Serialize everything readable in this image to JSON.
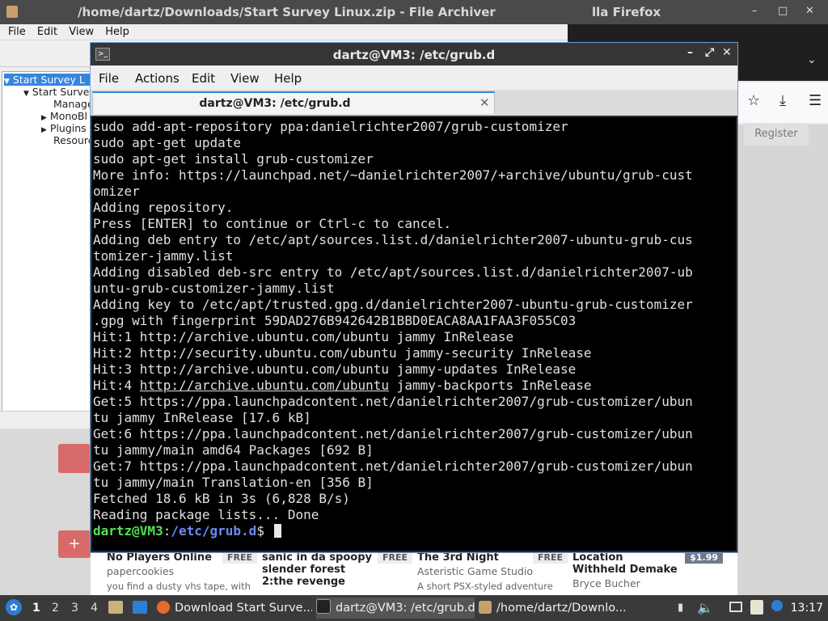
{
  "top_bar": {
    "archiver_title": "/home/dartz/Downloads/Start Survey Linux.zip - File Archiver",
    "firefox_title_fragment": "lla Firefox"
  },
  "archiver": {
    "menu": [
      "File",
      "Edit",
      "View",
      "Help"
    ],
    "tree": [
      "Start Survey L",
      "Start Surve",
      "Manage",
      "MonoBl",
      "Plugins",
      "Resourc"
    ]
  },
  "firefox": {
    "register_label": "Register"
  },
  "store": [
    {
      "title": "No Players Online",
      "price": "FREE",
      "studio": "papercookies",
      "desc": "you find a dusty vhs tape, with"
    },
    {
      "title": "sanic in da spoopy slender forest 2:the revenge",
      "price": "FREE",
      "studio": "",
      "desc": ""
    },
    {
      "title": "The 3rd Night",
      "price": "FREE",
      "studio": "Asteristic Game Studio",
      "desc": "A short PSX-styled adventure"
    },
    {
      "title": "Location Withheld Demake",
      "price": "$1.99",
      "studio": "Bryce Bucher",
      "desc": ""
    }
  ],
  "terminal": {
    "window_title": "dartz@VM3: /etc/grub.d",
    "menu": [
      "File",
      "Actions",
      "Edit",
      "View",
      "Help"
    ],
    "tab_title": "dartz@VM3: /etc/grub.d",
    "lines": [
      "sudo add-apt-repository ppa:danielrichter2007/grub-customizer",
      "sudo apt-get update",
      "sudo apt-get install grub-customizer",
      "More info: https://launchpad.net/~danielrichter2007/+archive/ubuntu/grub-cust",
      "omizer",
      "Adding repository.",
      "Press [ENTER] to continue or Ctrl-c to cancel.",
      "Adding deb entry to /etc/apt/sources.list.d/danielrichter2007-ubuntu-grub-cus",
      "tomizer-jammy.list",
      "Adding disabled deb-src entry to /etc/apt/sources.list.d/danielrichter2007-ub",
      "untu-grub-customizer-jammy.list",
      "Adding key to /etc/apt/trusted.gpg.d/danielrichter2007-ubuntu-grub-customizer",
      ".gpg with fingerprint 59DAD276B942642B1BBD0EACA8AA1FAA3F055C03",
      "Hit:1 http://archive.ubuntu.com/ubuntu jammy InRelease",
      "Hit:2 http://security.ubuntu.com/ubuntu jammy-security InRelease",
      "Hit:3 http://archive.ubuntu.com/ubuntu jammy-updates InRelease"
    ],
    "hit4_prefix": "Hit:4 ",
    "hit4_link": "http://archive.ubuntu.com/ubuntu",
    "hit4_suffix": " jammy-backports InRelease",
    "lines_after": [
      "Get:5 https://ppa.launchpadcontent.net/danielrichter2007/grub-customizer/ubun",
      "tu jammy InRelease [17.6 kB]",
      "Get:6 https://ppa.launchpadcontent.net/danielrichter2007/grub-customizer/ubun",
      "tu jammy/main amd64 Packages [692 B]",
      "Get:7 https://ppa.launchpadcontent.net/danielrichter2007/grub-customizer/ubun",
      "tu jammy/main Translation-en [356 B]",
      "Fetched 18.6 kB in 3s (6,828 B/s)",
      "Reading package lists... Done"
    ],
    "prompt_user": "dartz@VM3",
    "prompt_sep": ":",
    "prompt_path": "/etc/grub.d",
    "prompt_char": "$ "
  },
  "taskbar": {
    "workspaces": [
      "1",
      "2",
      "3",
      "4"
    ],
    "items": [
      {
        "label": "Download Start Surve..."
      },
      {
        "label": "dartz@VM3: /etc/grub.d"
      },
      {
        "label": "/home/dartz/Downlo..."
      }
    ],
    "clock": "13:17"
  }
}
